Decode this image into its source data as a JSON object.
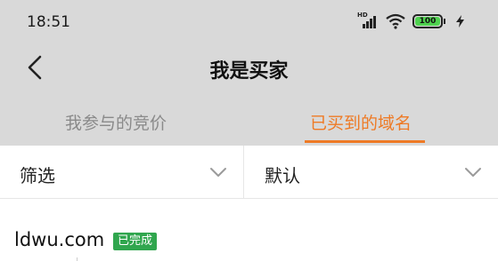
{
  "status_bar": {
    "time": "18:51",
    "signal_label": "HD",
    "battery_level": "100",
    "icons": [
      "hd-signal-icon",
      "wifi-icon",
      "battery-icon",
      "charging-bolt-icon"
    ]
  },
  "nav": {
    "title": "我是买家",
    "back_icon": "chevron-left-icon"
  },
  "tabs": [
    {
      "label": "我参与的竞价",
      "active": false
    },
    {
      "label": "已买到的域名",
      "active": true
    }
  ],
  "filters": {
    "filter_label": "筛选",
    "sort_label": "默认",
    "icon": "chevron-down-icon"
  },
  "list": {
    "items": [
      {
        "domain": "ldwu.com",
        "status": "已完成"
      }
    ]
  },
  "colors": {
    "header_bg": "#d9d9d9",
    "accent": "#ee7a25",
    "inactive_tab": "#8a8a8a",
    "badge_green": "#30a64e",
    "battery_green": "#4fd14f"
  }
}
